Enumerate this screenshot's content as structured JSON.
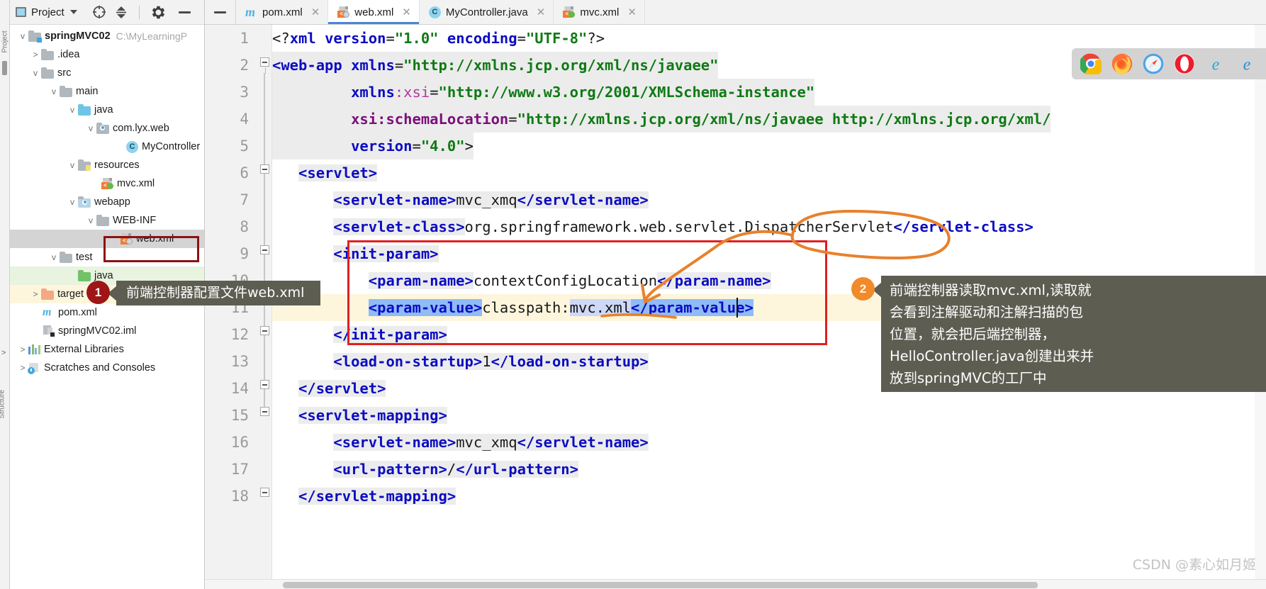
{
  "window": {
    "ide": "IntelliJ IDEA",
    "watermark": "CSDN @素心如月姬"
  },
  "project_panel": {
    "title": "Project",
    "icons": [
      "project-view-icon",
      "locate-icon",
      "collapse-all-icon",
      "settings-gear-icon",
      "hide-icon"
    ],
    "tree": [
      {
        "label": "springMVC02",
        "path": "C:\\MyLearningP",
        "depth": 0,
        "arrow": "v",
        "icon": "module-folder-icon",
        "bold": true
      },
      {
        "label": ".idea",
        "path": "",
        "depth": 1,
        "arrow": ">",
        "icon": "folder-icon",
        "bold": false
      },
      {
        "label": "src",
        "path": "",
        "depth": 1,
        "arrow": "v",
        "icon": "folder-icon",
        "bold": false
      },
      {
        "label": "main",
        "path": "",
        "depth": 2,
        "arrow": "v",
        "icon": "folder-icon",
        "bold": false
      },
      {
        "label": "java",
        "path": "",
        "depth": 3,
        "arrow": "v",
        "icon": "source-root-folder-icon",
        "bold": false
      },
      {
        "label": "com.lyx.web",
        "path": "",
        "depth": 4,
        "arrow": "v",
        "icon": "package-folder-icon",
        "bold": false
      },
      {
        "label": "MyController",
        "path": "",
        "depth": 5,
        "arrow": "",
        "icon": "java-class-icon",
        "bold": false
      },
      {
        "label": "resources",
        "path": "",
        "depth": 3,
        "arrow": "v",
        "icon": "resource-folder-icon",
        "bold": false
      },
      {
        "label": "mvc.xml",
        "path": "",
        "depth": 4,
        "arrow": "",
        "icon": "spring-xml-file-icon",
        "bold": false
      },
      {
        "label": "webapp",
        "path": "",
        "depth": 3,
        "arrow": "v",
        "icon": "web-folder-icon",
        "bold": false
      },
      {
        "label": "WEB-INF",
        "path": "",
        "depth": 4,
        "arrow": "v",
        "icon": "folder-icon",
        "bold": false
      },
      {
        "label": "web.xml",
        "path": "",
        "depth": 5,
        "arrow": "",
        "icon": "web-xml-file-icon",
        "bold": false
      },
      {
        "label": "test",
        "path": "",
        "depth": 2,
        "arrow": "v",
        "icon": "folder-icon",
        "bold": false
      },
      {
        "label": "java",
        "path": "",
        "depth": 3,
        "arrow": "",
        "icon": "test-source-folder-icon",
        "bold": false
      },
      {
        "label": "target",
        "path": "",
        "depth": 1,
        "arrow": ">",
        "icon": "excluded-folder-icon",
        "bold": false
      },
      {
        "label": "pom.xml",
        "path": "",
        "depth": 1,
        "arrow": "",
        "icon": "maven-pom-icon",
        "bold": false
      },
      {
        "label": "springMVC02.iml",
        "path": "",
        "depth": 1,
        "arrow": "",
        "icon": "iml-module-icon",
        "bold": false
      },
      {
        "label": "External Libraries",
        "path": "",
        "depth": 0,
        "arrow": ">",
        "icon": "libraries-icon",
        "bold": false
      },
      {
        "label": "Scratches and Consoles",
        "path": "",
        "depth": 0,
        "arrow": ">",
        "icon": "scratches-icon",
        "bold": false
      }
    ]
  },
  "tabs": [
    {
      "label": "pom.xml",
      "icon": "maven-pom-icon",
      "active": false
    },
    {
      "label": "web.xml",
      "icon": "web-xml-file-icon",
      "active": true
    },
    {
      "label": "MyController.java",
      "icon": "java-class-icon",
      "active": false
    },
    {
      "label": "mvc.xml",
      "icon": "spring-xml-file-icon",
      "active": false
    }
  ],
  "editor": {
    "file": "web.xml",
    "line_numbers": [
      1,
      2,
      3,
      4,
      5,
      6,
      7,
      8,
      9,
      10,
      11,
      12,
      13,
      14,
      15,
      16,
      17,
      18
    ],
    "lines": [
      {
        "n": 1,
        "text": "<?xml version=\"1.0\" encoding=\"UTF-8\"?>"
      },
      {
        "n": 2,
        "text": "<web-app xmlns=\"http://xmlns.jcp.org/xml/ns/javaee\""
      },
      {
        "n": 3,
        "text": "         xmlns:xsi=\"http://www.w3.org/2001/XMLSchema-instance\""
      },
      {
        "n": 4,
        "text": "         xsi:schemaLocation=\"http://xmlns.jcp.org/xml/ns/javaee http://xmlns.jcp.org/xml/"
      },
      {
        "n": 5,
        "text": "         version=\"4.0\">"
      },
      {
        "n": 6,
        "text": "    <servlet>"
      },
      {
        "n": 7,
        "text": "        <servlet-name>mvc_xmq</servlet-name>"
      },
      {
        "n": 8,
        "text": "        <servlet-class>org.springframework.web.servlet.DispatcherServlet</servlet-class>"
      },
      {
        "n": 9,
        "text": "        <init-param>"
      },
      {
        "n": 10,
        "text": "            <param-name>contextConfigLocation</param-name>"
      },
      {
        "n": 11,
        "text": "            <param-value>classpath:mvc.xml</param-value>"
      },
      {
        "n": 12,
        "text": "        </init-param>"
      },
      {
        "n": 13,
        "text": "        <load-on-startup>1</load-on-startup>"
      },
      {
        "n": 14,
        "text": "    </servlet>"
      },
      {
        "n": 15,
        "text": "    <servlet-mapping>"
      },
      {
        "n": 16,
        "text": "        <servlet-name>mvc_xmq</servlet-name>"
      },
      {
        "n": 17,
        "text": "        <url-pattern>/</url-pattern>"
      },
      {
        "n": 18,
        "text": "    </servlet-mapping>"
      }
    ]
  },
  "annotations": {
    "callout1": {
      "number": "1",
      "text": "前端控制器配置文件web.xml",
      "badge_color": "#9e1616",
      "box_color": "#5d5d52"
    },
    "callout2": {
      "number": "2",
      "text_lines": [
        "前端控制器读取mvc.xml,读取就",
        "会看到注解驱动和注解扫描的包",
        "位置，就会把后端控制器，",
        "HelloController.java创建出来并",
        "放到springMVC的工厂中"
      ],
      "badge_color": "#f08a2a",
      "box_color": "#5d5d52"
    },
    "red_box_label": "init-param-highlight-box",
    "red_box_color": "#e02020",
    "dark_box_label": "web-xml-tree-highlight-box",
    "dark_box_color": "#8c1212",
    "circle_label": "DispatcherServlet",
    "circle_color": "#e8812c"
  },
  "browser_strip": {
    "icons": [
      "chrome-icon",
      "firefox-icon",
      "safari-icon",
      "opera-icon",
      "internet-explorer-icon",
      "edge-icon"
    ]
  },
  "side_strip": {
    "labels": [
      "Project",
      "Structure"
    ]
  }
}
